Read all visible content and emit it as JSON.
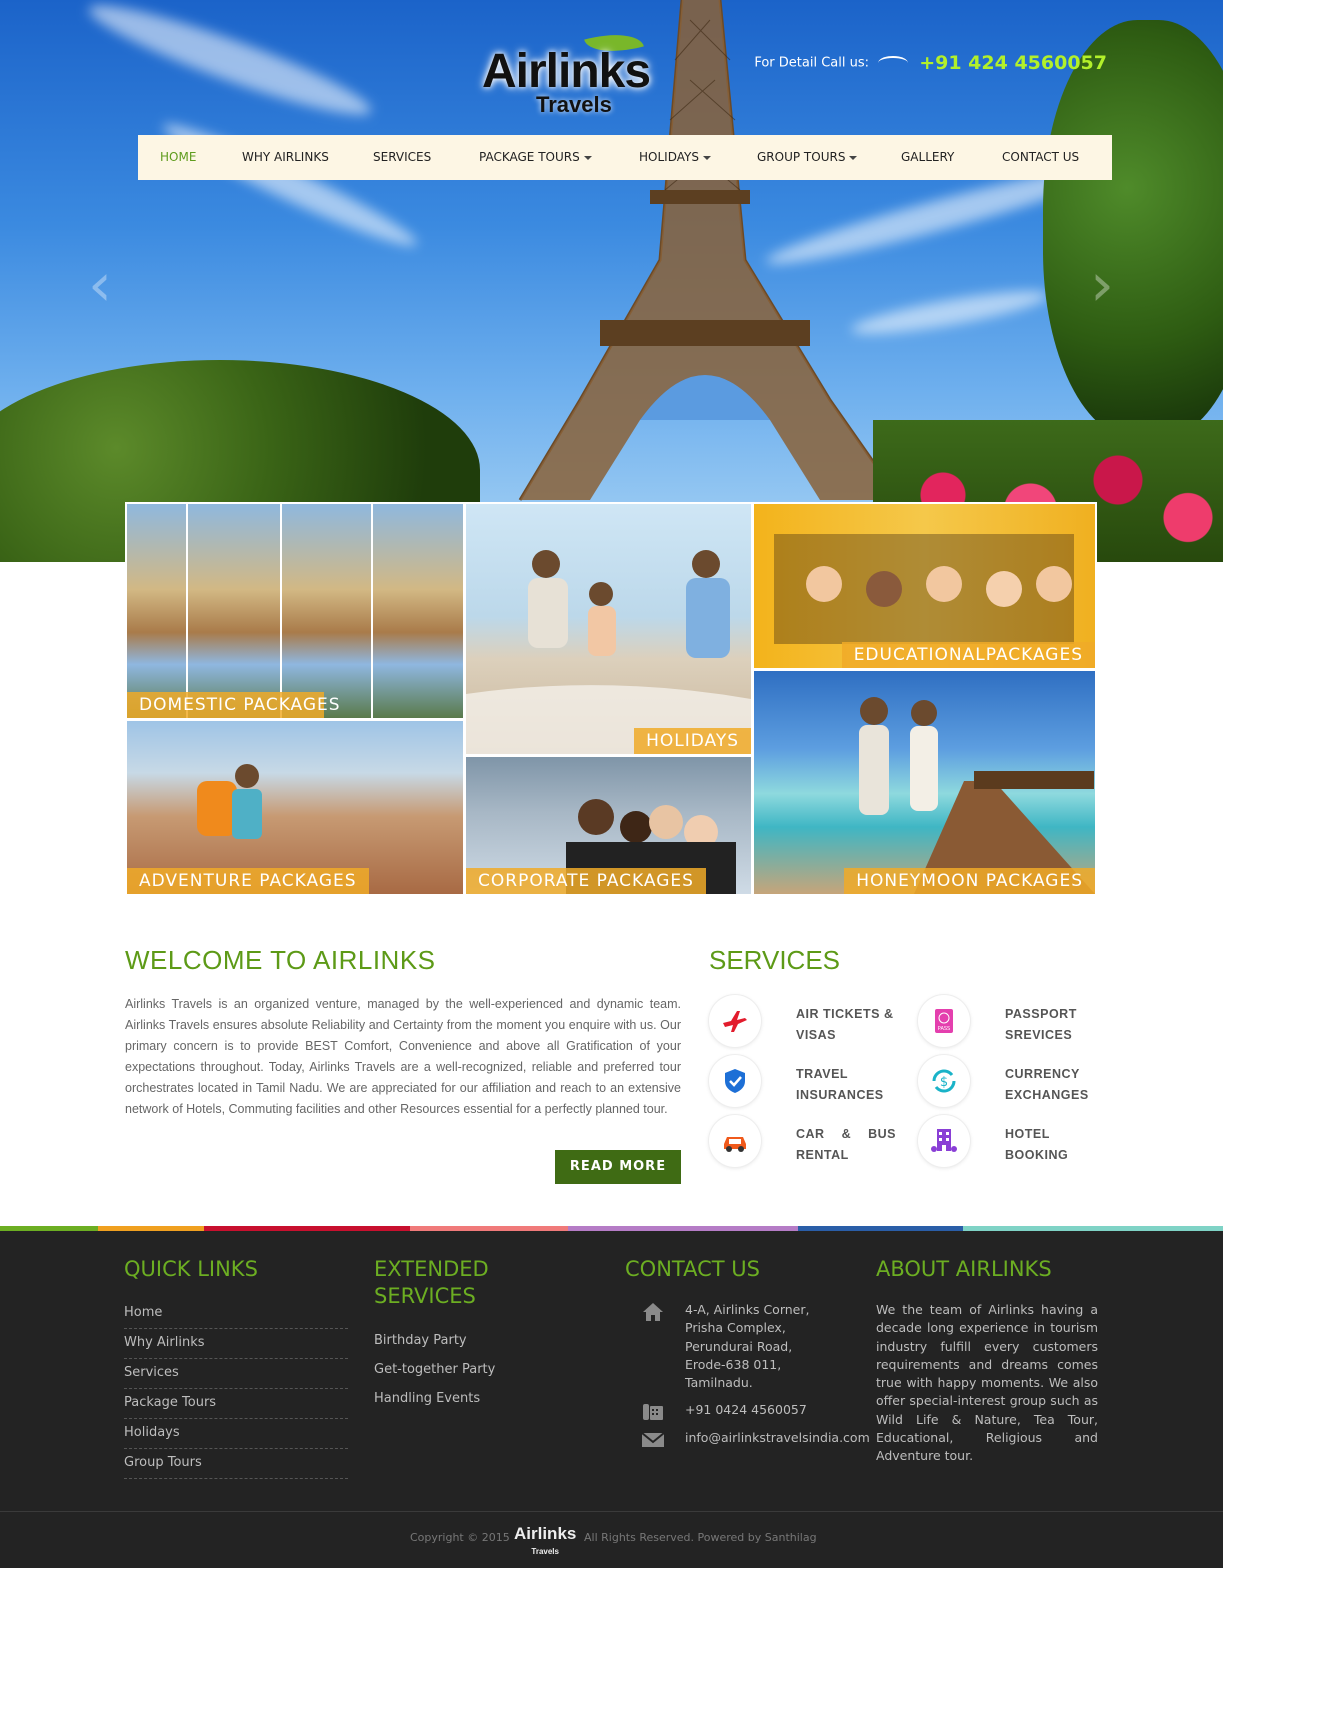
{
  "header": {
    "logo_main": "Airlinks",
    "logo_sub": "Travels",
    "call_label": "For Detail Call us:",
    "phone": "+91 424 4560057"
  },
  "nav": {
    "items": [
      {
        "label": "HOME",
        "dropdown": false,
        "active": true
      },
      {
        "label": "WHY AIRLINKS",
        "dropdown": false
      },
      {
        "label": "SERVICES",
        "dropdown": false
      },
      {
        "label": "PACKAGE TOURS",
        "dropdown": true
      },
      {
        "label": "HOLIDAYS",
        "dropdown": true
      },
      {
        "label": "GROUP TOURS",
        "dropdown": true
      },
      {
        "label": "GALLERY",
        "dropdown": false
      },
      {
        "label": "CONTACT US",
        "dropdown": false
      }
    ]
  },
  "tiles": {
    "domestic": "DOMESTIC PACKAGES",
    "holidays": "HOLIDAYS",
    "educational": "EDUCATIONALPACKAGES",
    "adventure": "ADVENTURE PACKAGES",
    "corporate": "CORPORATE PACKAGES",
    "honeymoon": "HONEYMOON PACKAGES"
  },
  "welcome": {
    "title": "WELCOME TO AIRLINKS",
    "body": "Airlinks Travels is an organized venture, managed by the well-experienced and dynamic team. Airlinks Travels ensures absolute Reliability and Certainty from the moment you enquire with us. Our primary concern is to provide BEST Comfort, Convenience and above all Gratification of your expectations throughout. Today, Airlinks Travels are a well-recognized, reliable and preferred tour orchestrates located in Tamil Nadu. We are appreciated for our affiliation and reach to an extensive network of Hotels, Commuting facilities and other Resources essential for a perfectly planned tour.",
    "read_more": "READ MORE"
  },
  "services": {
    "title": "SERVICES",
    "items": [
      {
        "label": "AIR TICKETS & VISAS",
        "icon": "airplane-icon"
      },
      {
        "label": "PASSPORT SREVICES",
        "icon": "passport-icon",
        "icon_text": "PASS"
      },
      {
        "label": "TRAVEL INSURANCES",
        "icon": "shield-check-icon"
      },
      {
        "label": "CURRENCY EXCHANGES",
        "icon": "currency-exchange-icon"
      },
      {
        "label": "CAR & BUS RENTAL",
        "icon": "car-icon"
      },
      {
        "label": "HOTEL BOOKING",
        "icon": "hotel-icon"
      }
    ]
  },
  "footer": {
    "quick_links": {
      "title": "QUICK LINKS",
      "items": [
        "Home",
        "Why Airlinks",
        "Services",
        "Package Tours",
        "Holidays",
        "Group Tours"
      ]
    },
    "extended": {
      "title_line1": "EXTENDED",
      "title_line2": "SERVICES",
      "items": [
        "Birthday Party",
        "Get-together Party",
        "Handling Events"
      ]
    },
    "contact": {
      "title": "CONTACT US",
      "address_lines": [
        "4-A, Airlinks Corner,",
        "Prisha Complex,",
        "Perundurai Road,",
        "Erode-638 011,",
        "Tamilnadu."
      ],
      "phone": "+91 0424 4560057",
      "email": "info@airlinkstravelsindia.com"
    },
    "about": {
      "title": "ABOUT AIRLINKS",
      "body": "We the team of Airlinks having a decade long experience in tourism industry fulfill every customers requirements and dreams comes true with happy moments. We also offer special-interest group such as Wild Life & Nature, Tea Tour, Educational, Religious and Adventure tour."
    },
    "copyright": "Copyright © 2015",
    "logo_main": "Airlinks",
    "logo_sub": "Travels",
    "rights": "All Rights Reserved. Powered by Santhilag"
  },
  "colors": {
    "accent_green": "#5d9a17",
    "button_green": "#3f6b14",
    "footer_bg": "#232323",
    "tile_label_bg": "#f0aa28"
  }
}
